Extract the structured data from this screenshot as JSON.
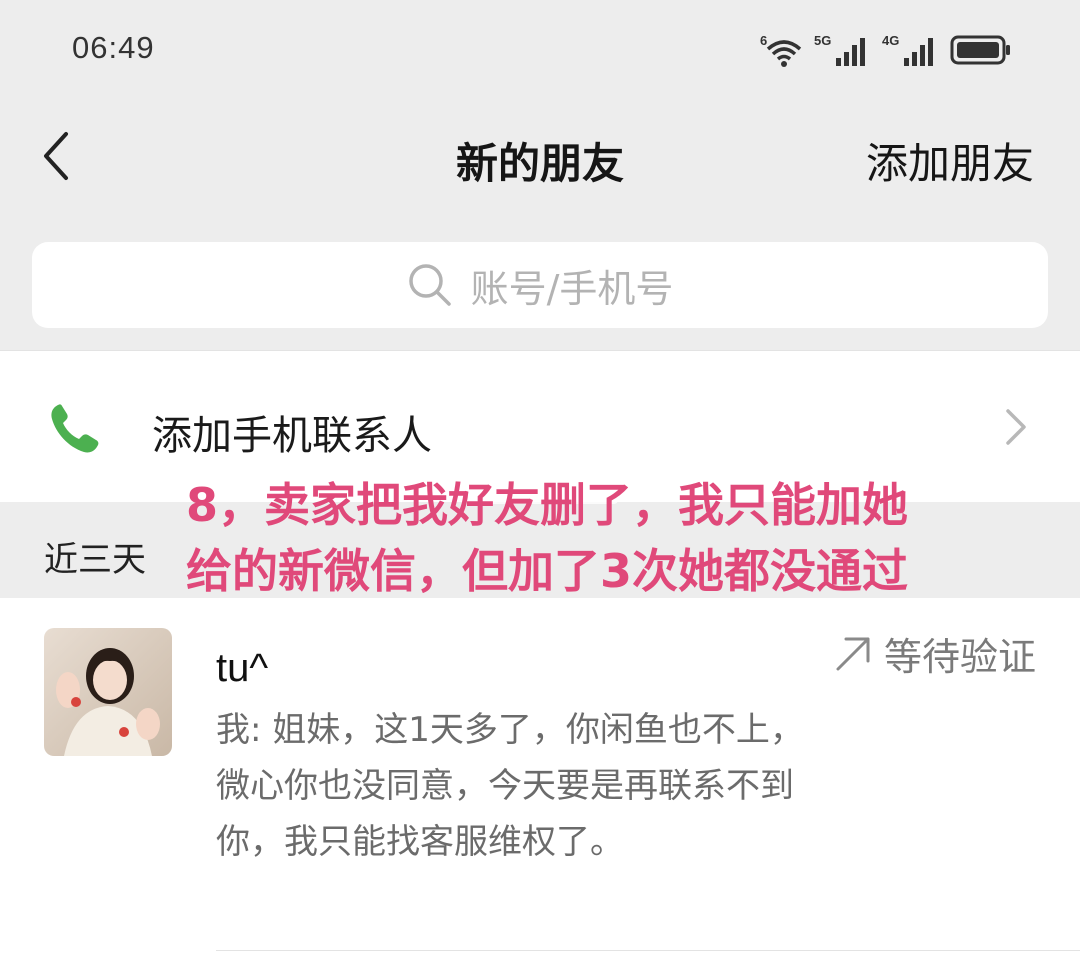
{
  "status_bar": {
    "time": "06:49",
    "wifi_label": "6",
    "sim1_label": "5G",
    "sim2_label": "4G"
  },
  "nav": {
    "title": "新的朋友",
    "action_label": "添加朋友"
  },
  "search": {
    "placeholder": "账号/手机号"
  },
  "contacts_entry": {
    "label": "添加手机联系人"
  },
  "section": {
    "label": "近三天"
  },
  "request": {
    "name": "tu^",
    "message": "我: 姐妹，这1天多了，你闲鱼也不上，微心你也没同意，今天要是再联系不到你，我只能找客服维权了。",
    "status": "等待验证"
  },
  "annotation": {
    "text": "8，卖家把我好友删了，我只能加她给的新微信，但加了3次她都没通过"
  },
  "colors": {
    "background": "#ededed",
    "accent_green": "#07c160",
    "annotation_pink": "#e0497a"
  }
}
